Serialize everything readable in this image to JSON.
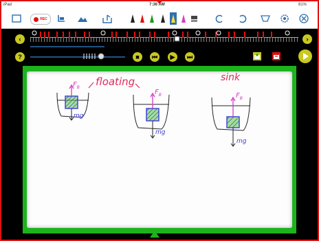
{
  "status": {
    "device": "iPad",
    "time": "7:36 AM",
    "battery": "81%"
  },
  "toolbar": {
    "rec_label": "REC"
  },
  "board": {
    "title": "floating",
    "sink_label": "sink",
    "left_force_up": "F",
    "left_force_up_sub": "B",
    "left_force_down": "mg",
    "mid_force_up": "F",
    "mid_force_up_sub": "B",
    "mid_force_down": "mg",
    "right_force_up": "F",
    "right_force_up_sub": "B",
    "right_force_down": "mg"
  },
  "colors": {
    "frame_border": "#e01010",
    "board_frame": "#1db31d",
    "ink_red": "#e22a5a",
    "ink_blue": "#3b3bd6",
    "ink_magenta": "#d43ac4",
    "object_fill": "#57c93c"
  }
}
